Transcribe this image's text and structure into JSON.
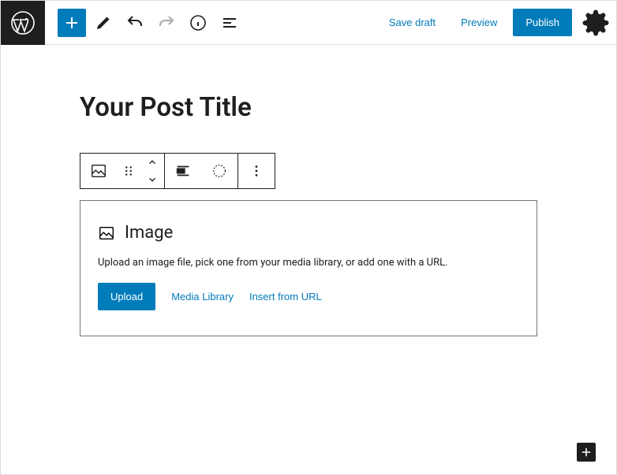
{
  "topbar": {
    "save_draft": "Save draft",
    "preview": "Preview",
    "publish": "Publish"
  },
  "editor": {
    "post_title": "Your Post Title"
  },
  "image_block": {
    "title": "Image",
    "description": "Upload an image file, pick one from your media library, or add one with a URL.",
    "upload_label": "Upload",
    "media_library_label": "Media Library",
    "insert_url_label": "Insert from URL"
  }
}
